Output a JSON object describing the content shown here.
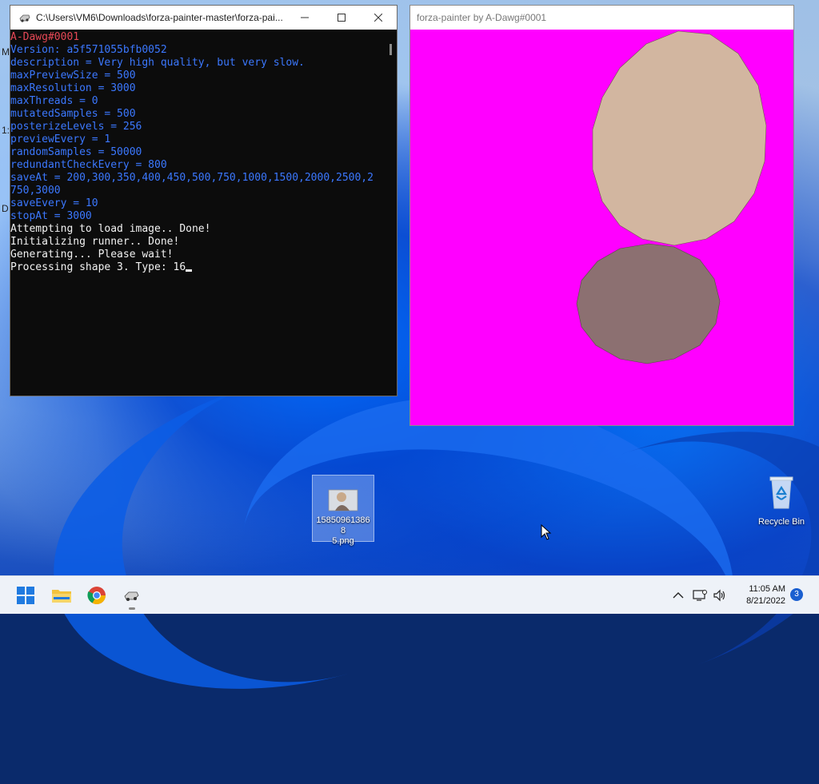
{
  "console_window": {
    "title": "C:\\Users\\VM6\\Downloads\\forza-painter-master\\forza-pai...",
    "icon": "console-app-icon",
    "lines": [
      {
        "text": "A-Dawg#0001",
        "color": "red"
      },
      {
        "text": "Version: a5f571055bfb0052",
        "color": "blue"
      },
      {
        "text": "description = Very high quality, but very slow.",
        "color": "blue"
      },
      {
        "text": "maxPreviewSize = 500",
        "color": "blue"
      },
      {
        "text": "maxResolution = 3000",
        "color": "blue"
      },
      {
        "text": "maxThreads = 0",
        "color": "blue"
      },
      {
        "text": "mutatedSamples = 500",
        "color": "blue"
      },
      {
        "text": "posterizeLevels = 256",
        "color": "blue"
      },
      {
        "text": "previewEvery = 1",
        "color": "blue"
      },
      {
        "text": "randomSamples = 50000",
        "color": "blue"
      },
      {
        "text": "redundantCheckEvery = 800",
        "color": "blue"
      },
      {
        "text": "saveAt = 200,300,350,400,450,500,750,1000,1500,2000,2500,2",
        "color": "blue"
      },
      {
        "text": "750,3000",
        "color": "blue"
      },
      {
        "text": "saveEvery = 10",
        "color": "blue"
      },
      {
        "text": "stopAt = 3000",
        "color": "blue"
      },
      {
        "text": "Attempting to load image.. Done!",
        "color": "white"
      },
      {
        "text": "Initializing runner.. Done!",
        "color": "white"
      },
      {
        "text": "Generating... Please wait!",
        "color": "white"
      },
      {
        "text": "Processing shape 3. Type: 16",
        "color": "white"
      }
    ],
    "edge_glyphs": [
      "M",
      "1:",
      "D"
    ]
  },
  "painter_window": {
    "title": "forza-painter by A-Dawg#0001",
    "canvas_bg": "#ff00ff",
    "shapes": [
      {
        "name": "ellipse-tan",
        "fill": "#d2b6a0"
      },
      {
        "name": "ellipse-mauve",
        "fill": "#8c7071"
      }
    ]
  },
  "desktop": {
    "file_icon": {
      "name": "1585096138685.png",
      "label": "158509613868\n5.png"
    },
    "recycle_bin": {
      "label": "Recycle Bin"
    }
  },
  "taskbar": {
    "apps": [
      "start-icon",
      "file-explorer-icon",
      "chrome-icon",
      "console-app-icon"
    ],
    "tray_icons": [
      "chevron-up-icon",
      "network-icon",
      "volume-icon"
    ],
    "time": "11:05 AM",
    "date": "8/21/2022",
    "notification_count": "3"
  },
  "colors": {
    "console_red": "#e74856",
    "console_blue": "#3b78ff",
    "console_white": "#f2f2f2",
    "magenta": "#ff00ff"
  }
}
